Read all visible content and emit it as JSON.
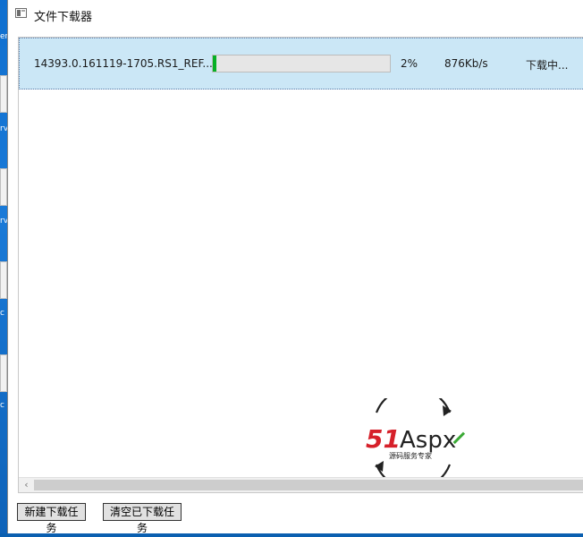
{
  "window": {
    "title": "文件下载器"
  },
  "desktop_fragments": [
    "er",
    "rv",
    "rv",
    "c",
    "c"
  ],
  "tasks": [
    {
      "filename": "14393.0.161119-1705.RS1_REF...",
      "progress": 2,
      "percent_label": "2%",
      "speed": "876Kb/s",
      "status": "下载中..."
    }
  ],
  "logo": {
    "brand_red": "51",
    "brand_black": "Aspx",
    "tagline": "源码服务专家",
    "colors": {
      "red": "#d6202a",
      "green": "#3aa935",
      "dark": "#222222"
    }
  },
  "buttons": {
    "new_task": "新建下载任务",
    "clear_tasks": "清空已下载任务"
  },
  "colors": {
    "row_selected_bg": "#cbe7f6",
    "progress_green": "#06b025"
  }
}
